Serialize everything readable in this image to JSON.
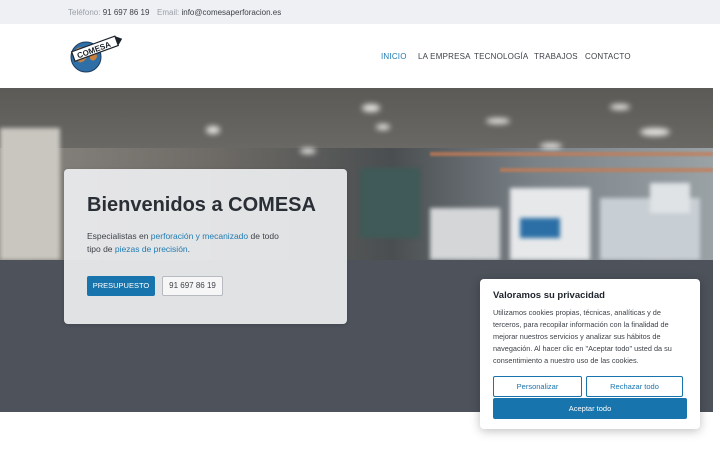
{
  "topbar": {
    "phone_label": "Teléfono:",
    "phone_value": "91 697 86 19",
    "email_label": "Email:",
    "email_value": "info@comesaperforacion.es"
  },
  "logo": {
    "text": "COMESA"
  },
  "nav": {
    "items": [
      {
        "label": "INICIO"
      },
      {
        "label": "LA EMPRESA"
      },
      {
        "label": "TECNOLOGÍA"
      },
      {
        "label": "TRABAJOS"
      },
      {
        "label": "CONTACTO"
      }
    ]
  },
  "hero": {
    "title": "Bienvenidos a COMESA",
    "intro_1": "Especialistas en ",
    "intro_link_1": "perforación y mecanizado",
    "intro_2": " de todo tipo de ",
    "intro_link_2": "piezas de precisión",
    "intro_3": ".",
    "budget_button": "PRESUPUESTO",
    "phone_button": "91 697 86 19"
  },
  "cookie": {
    "title": "Valoramos su privacidad",
    "text": "Utilizamos cookies propias, técnicas, analíticas y de terceros, para recopilar información con la finalidad de mejorar nuestros servicios y analizar sus hábitos de navegación. Al hacer clic en \"Aceptar todo\" usted da su consentimiento a nuestro uso de las cookies.",
    "customize_button": "Personalizar",
    "reject_button": "Rechazar todo",
    "accept_button": "Aceptar todo"
  },
  "colors": {
    "accent": "#1874ac",
    "link": "#1e7bb3",
    "topbar_bg": "#eef0f4",
    "dark_band": "#4d525b"
  }
}
